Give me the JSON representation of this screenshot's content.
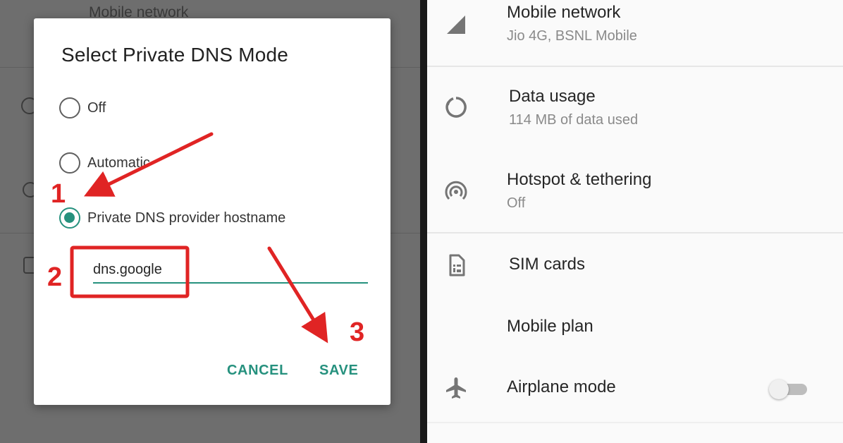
{
  "dialog": {
    "title": "Select Private DNS Mode",
    "options": [
      {
        "label": "Off",
        "selected": false
      },
      {
        "label": "Automatic",
        "selected": false
      },
      {
        "label": "Private DNS provider hostname",
        "selected": true
      }
    ],
    "hostname_value": "dns.google",
    "cancel_label": "CANCEL",
    "save_label": "SAVE"
  },
  "annotations": {
    "step1": "1",
    "step2": "2",
    "step3": "3",
    "color": "#e02424"
  },
  "background_left": {
    "top_item": "Mobile network"
  },
  "settings": {
    "items": [
      {
        "title": "Mobile network",
        "subtitle": "Jio 4G, BSNL Mobile",
        "icon": "signal-icon"
      },
      {
        "title": "Data usage",
        "subtitle": "114 MB of data used",
        "icon": "data-usage-icon"
      },
      {
        "title": "Hotspot & tethering",
        "subtitle": "Off",
        "icon": "hotspot-icon"
      },
      {
        "title": "SIM cards",
        "subtitle": "",
        "icon": "sim-card-icon"
      },
      {
        "title": "Mobile plan",
        "subtitle": "",
        "icon": ""
      },
      {
        "title": "Airplane mode",
        "subtitle": "",
        "icon": "airplane-icon",
        "toggle_on": false
      }
    ]
  },
  "colors": {
    "accent": "#26917e",
    "annotation": "#e02424",
    "scrim": "#6e6e6e"
  }
}
